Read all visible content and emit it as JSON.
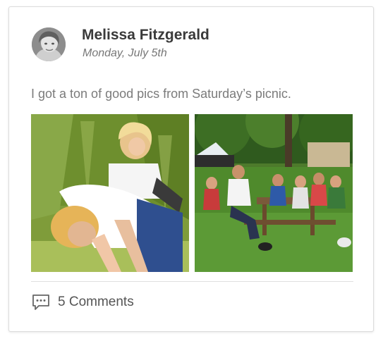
{
  "post": {
    "author_name": "Melissa Fitzgerald",
    "date": "Monday, July 5th",
    "text": "I got a ton of good pics from Saturday’s picnic.",
    "comments_label": "5 Comments",
    "icons": {
      "comments": "comment-bubble-icon",
      "avatar": "user-photo"
    },
    "colors": {
      "author": "#3a3a3a",
      "date": "#777777",
      "body_text": "#7b7b7b",
      "border": "#dcdcdc"
    }
  }
}
